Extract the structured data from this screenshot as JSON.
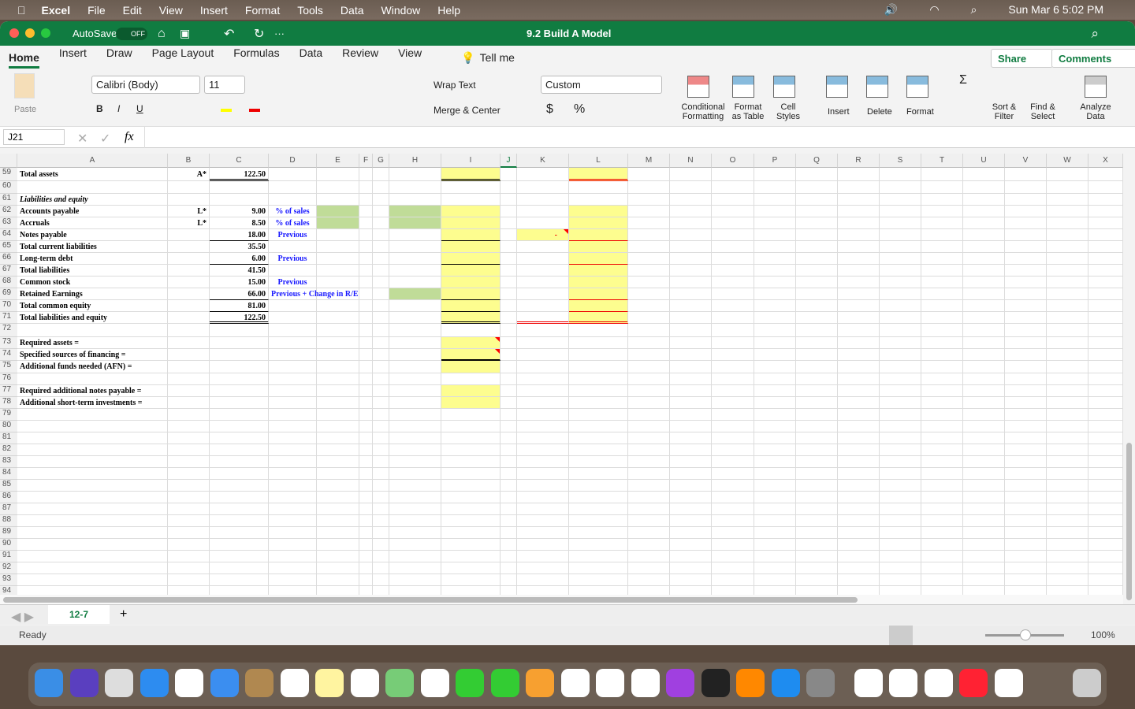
{
  "menubar": {
    "app": "Excel",
    "items": [
      "File",
      "Edit",
      "View",
      "Insert",
      "Format",
      "Tools",
      "Data",
      "Window",
      "Help"
    ],
    "clock": "Sun Mar 6  5:02 PM"
  },
  "titlebar": {
    "autosave": "AutoSave",
    "toggle": "OFF",
    "doc": "9.2 Build A Model"
  },
  "tabs": [
    "Home",
    "Insert",
    "Draw",
    "Page Layout",
    "Formulas",
    "Data",
    "Review",
    "View"
  ],
  "tell_me": "Tell me",
  "share": "Share",
  "comments": "Comments",
  "ribbon": {
    "paste": "Paste",
    "font": "Calibri (Body)",
    "size": "11",
    "wrap": "Wrap Text",
    "merge": "Merge & Center",
    "number_format": "Custom",
    "cond": "Conditional Formatting",
    "fmt_table": "Format as Table",
    "cell_styles": "Cell Styles",
    "insert": "Insert",
    "delete": "Delete",
    "format": "Format",
    "sort": "Sort & Filter",
    "find": "Find & Select",
    "analyze": "Analyze Data",
    "bold": "B",
    "italic": "I",
    "underline": "U"
  },
  "formula_bar": {
    "name_box": "J21",
    "fx": "fx",
    "value": ""
  },
  "columns": [
    "A",
    "B",
    "C",
    "D",
    "E",
    "F",
    "G",
    "H",
    "I",
    "J",
    "K",
    "L",
    "M",
    "N",
    "O",
    "P",
    "Q",
    "R",
    "S",
    "T",
    "U",
    "V",
    "W",
    "X"
  ],
  "active_column": "J",
  "colors": {
    "yellow": "#fdfd8f",
    "green": "#c0dc98",
    "blue_text": "#1a1aff",
    "accent": "#107c41"
  },
  "rows": [
    {
      "n": 59,
      "cells": {
        "A": "Total assets",
        "B": "A*",
        "C": "122.50"
      }
    },
    {
      "n": 60,
      "cells": {}
    },
    {
      "n": 61,
      "cells": {
        "A": "Liabilities and equity"
      }
    },
    {
      "n": 62,
      "cells": {
        "A": "Accounts payable",
        "B": "L*",
        "C": "9.00",
        "D": "% of sales"
      }
    },
    {
      "n": 63,
      "cells": {
        "A": "Accruals",
        "B": "L*",
        "C": "8.50",
        "D": "% of sales"
      }
    },
    {
      "n": 64,
      "cells": {
        "A": "Notes payable",
        "C": "18.00",
        "D": "Previous",
        "K": "-"
      }
    },
    {
      "n": 65,
      "cells": {
        "A": "   Total current liabilities",
        "C": "35.50"
      }
    },
    {
      "n": 66,
      "cells": {
        "A": "Long-term debt",
        "C": "6.00",
        "D": "Previous"
      }
    },
    {
      "n": 67,
      "cells": {
        "A": "   Total liabilities",
        "C": "41.50"
      }
    },
    {
      "n": 68,
      "cells": {
        "A": "Common stock",
        "C": "15.00",
        "D": "Previous"
      }
    },
    {
      "n": 69,
      "cells": {
        "A": "Retained Earnings",
        "C": "66.00",
        "D": "Previous + Change in R/E"
      }
    },
    {
      "n": 70,
      "cells": {
        "A": "   Total common equity",
        "C": "81.00"
      }
    },
    {
      "n": 71,
      "cells": {
        "A": "Total liabilities and equity",
        "C": "122.50"
      }
    },
    {
      "n": 72,
      "cells": {}
    },
    {
      "n": 73,
      "cells": {
        "A": "Required assets ="
      }
    },
    {
      "n": 74,
      "cells": {
        "A": "Specified sources of financing ="
      }
    },
    {
      "n": 75,
      "cells": {
        "A": "Additional funds needed (AFN) ="
      }
    },
    {
      "n": 76,
      "cells": {}
    },
    {
      "n": 77,
      "cells": {
        "A": "Required additional notes payable ="
      }
    },
    {
      "n": 78,
      "cells": {
        "A": "Additional short-term investments ="
      }
    },
    {
      "n": 79,
      "cells": {}
    },
    {
      "n": 80,
      "cells": {}
    },
    {
      "n": 81,
      "cells": {}
    },
    {
      "n": 82,
      "cells": {}
    },
    {
      "n": 83,
      "cells": {}
    },
    {
      "n": 84,
      "cells": {}
    },
    {
      "n": 85,
      "cells": {}
    },
    {
      "n": 86,
      "cells": {}
    },
    {
      "n": 87,
      "cells": {}
    },
    {
      "n": 88,
      "cells": {}
    },
    {
      "n": 89,
      "cells": {}
    },
    {
      "n": 90,
      "cells": {}
    },
    {
      "n": 91,
      "cells": {}
    },
    {
      "n": 92,
      "cells": {}
    },
    {
      "n": 93,
      "cells": {}
    },
    {
      "n": 94,
      "cells": {}
    }
  ],
  "yellow_cells": [
    "I59",
    "L59",
    "I62",
    "L62",
    "I63",
    "L63",
    "I64",
    "K64",
    "L64",
    "I65",
    "L65",
    "I66",
    "L66",
    "I67",
    "L67",
    "I68",
    "L68",
    "I69",
    "L69",
    "I70",
    "L70",
    "I71",
    "L71",
    "I73",
    "I74",
    "I75",
    "I77",
    "I78"
  ],
  "green_cells": [
    "E62",
    "E63",
    "H62",
    "H63",
    "H69"
  ],
  "comment_cells": [
    "K64",
    "I73",
    "I74"
  ],
  "sheet_tab": "12-7",
  "status": "Ready",
  "zoom": "100%"
}
